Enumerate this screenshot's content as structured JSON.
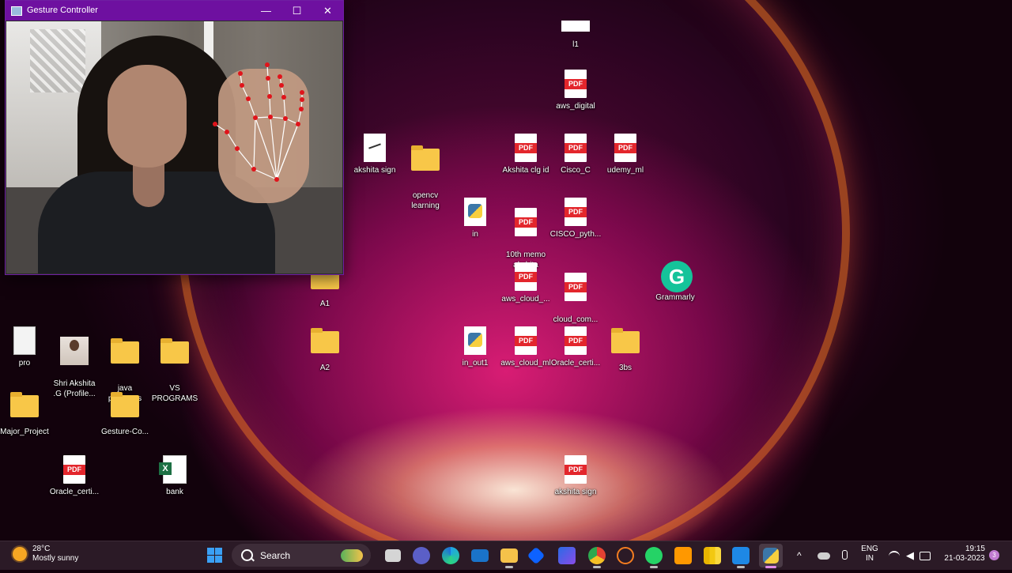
{
  "gesture_window": {
    "title": "Gesture Controller",
    "minimize_icon": "minimize-icon",
    "maximize_icon": "maximize-icon",
    "close_icon": "close-icon"
  },
  "desktop_icons": [
    {
      "label": "l1",
      "kind": "doc-thumb"
    },
    {
      "label": "aws_digital",
      "kind": "pdf"
    },
    {
      "label": "akshita sign",
      "kind": "image"
    },
    {
      "label": "opencv\nlearning",
      "kind": "folder"
    },
    {
      "label": "Akshita clg id",
      "kind": "pdf"
    },
    {
      "label": "Cisco_C",
      "kind": "pdf"
    },
    {
      "label": "udemy_ml",
      "kind": "pdf"
    },
    {
      "label": "in",
      "kind": "python"
    },
    {
      "label": "10th memo\nakshita",
      "kind": "pdf"
    },
    {
      "label": "CISCO_pyth...",
      "kind": "pdf"
    },
    {
      "label": "A1",
      "kind": "folder"
    },
    {
      "label": "aws_cloud_...",
      "kind": "pdf"
    },
    {
      "label": "cloud_com...\n101",
      "kind": "pdf"
    },
    {
      "label": "Grammarly",
      "kind": "grammarly"
    },
    {
      "label": "pro",
      "kind": "doc"
    },
    {
      "label": "Shri Akshita\n.G (Profile...",
      "kind": "photo"
    },
    {
      "label": "java\nprograms",
      "kind": "folder"
    },
    {
      "label": "VS\nPROGRAMS",
      "kind": "folder"
    },
    {
      "label": "A2",
      "kind": "folder"
    },
    {
      "label": "in_out1",
      "kind": "python"
    },
    {
      "label": "aws_cloud_ml",
      "kind": "pdf"
    },
    {
      "label": "Oracle_certi...",
      "kind": "pdf"
    },
    {
      "label": "3bs",
      "kind": "folder"
    },
    {
      "label": "Major_Project",
      "kind": "folder"
    },
    {
      "label": "Gesture-Co...",
      "kind": "folder"
    },
    {
      "label": "Oracle_certi...",
      "kind": "pdf"
    },
    {
      "label": "bank",
      "kind": "excel"
    },
    {
      "label": "akshita sign",
      "kind": "pdf"
    }
  ],
  "pdf_badge": "PDF",
  "taskbar": {
    "weather_temp": "28°C",
    "weather_desc": "Mostly sunny",
    "search_label": "Search",
    "apps": [
      "widgets",
      "file-explorer-mini",
      "teams-chat",
      "edge",
      "mail",
      "file-explorer",
      "dropbox",
      "copilot",
      "chrome",
      "jupyter",
      "whatsapp",
      "sublime-text",
      "power-bi",
      "vscode",
      "python"
    ],
    "lang_top": "ENG",
    "lang_bottom": "IN",
    "time": "19:15",
    "date": "21-03-2023",
    "notification_count": "3"
  }
}
